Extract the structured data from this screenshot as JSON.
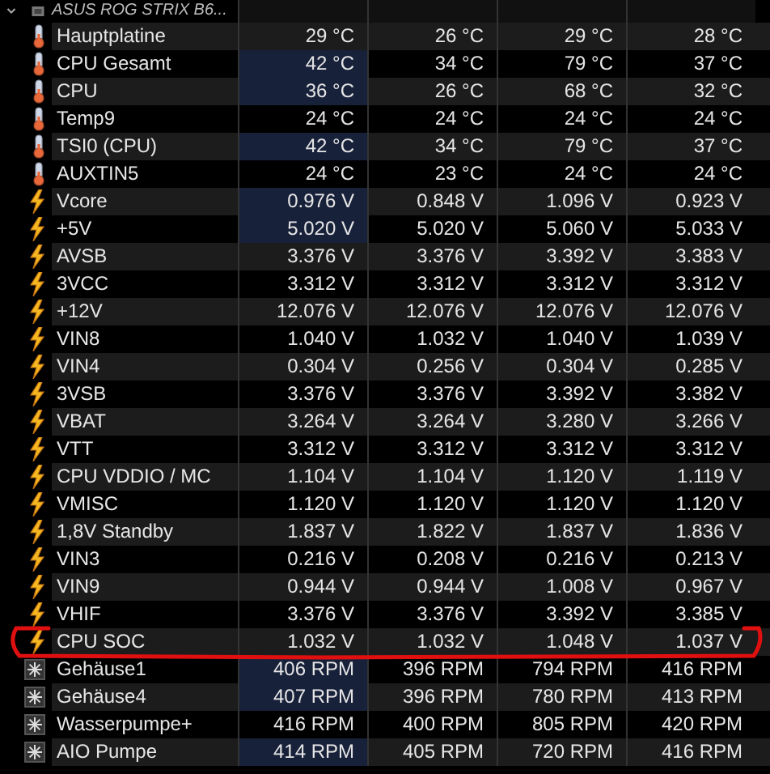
{
  "group": {
    "title": "ASUS ROG STRIX B6..."
  },
  "sensors": [
    {
      "kind": "temperature",
      "name": "Hauptplatine",
      "highlighted": false,
      "values": [
        "29 °C",
        "26 °C",
        "29 °C",
        "28 °C"
      ]
    },
    {
      "kind": "temperature",
      "name": "CPU Gesamt",
      "highlighted": true,
      "values": [
        "42 °C",
        "34 °C",
        "79 °C",
        "37 °C"
      ]
    },
    {
      "kind": "temperature",
      "name": "CPU",
      "highlighted": true,
      "values": [
        "36 °C",
        "26 °C",
        "68 °C",
        "32 °C"
      ]
    },
    {
      "kind": "temperature",
      "name": "Temp9",
      "highlighted": false,
      "values": [
        "24 °C",
        "24 °C",
        "24 °C",
        "24 °C"
      ]
    },
    {
      "kind": "temperature",
      "name": "TSI0 (CPU)",
      "highlighted": true,
      "values": [
        "42 °C",
        "34 °C",
        "79 °C",
        "37 °C"
      ]
    },
    {
      "kind": "temperature",
      "name": "AUXTIN5",
      "highlighted": false,
      "values": [
        "24 °C",
        "23 °C",
        "24 °C",
        "24 °C"
      ]
    },
    {
      "kind": "voltage",
      "name": "Vcore",
      "highlighted": true,
      "values": [
        "0.976 V",
        "0.848 V",
        "1.096 V",
        "0.923 V"
      ]
    },
    {
      "kind": "voltage",
      "name": "+5V",
      "highlighted": true,
      "values": [
        "5.020 V",
        "5.020 V",
        "5.060 V",
        "5.033 V"
      ]
    },
    {
      "kind": "voltage",
      "name": "AVSB",
      "highlighted": false,
      "values": [
        "3.376 V",
        "3.376 V",
        "3.392 V",
        "3.383 V"
      ]
    },
    {
      "kind": "voltage",
      "name": "3VCC",
      "highlighted": false,
      "values": [
        "3.312 V",
        "3.312 V",
        "3.312 V",
        "3.312 V"
      ]
    },
    {
      "kind": "voltage",
      "name": "+12V",
      "highlighted": false,
      "values": [
        "12.076 V",
        "12.076 V",
        "12.076 V",
        "12.076 V"
      ]
    },
    {
      "kind": "voltage",
      "name": "VIN8",
      "highlighted": false,
      "values": [
        "1.040 V",
        "1.032 V",
        "1.040 V",
        "1.039 V"
      ]
    },
    {
      "kind": "voltage",
      "name": "VIN4",
      "highlighted": false,
      "values": [
        "0.304 V",
        "0.256 V",
        "0.304 V",
        "0.285 V"
      ]
    },
    {
      "kind": "voltage",
      "name": "3VSB",
      "highlighted": false,
      "values": [
        "3.376 V",
        "3.376 V",
        "3.392 V",
        "3.382 V"
      ]
    },
    {
      "kind": "voltage",
      "name": "VBAT",
      "highlighted": false,
      "values": [
        "3.264 V",
        "3.264 V",
        "3.280 V",
        "3.266 V"
      ]
    },
    {
      "kind": "voltage",
      "name": "VTT",
      "highlighted": false,
      "values": [
        "3.312 V",
        "3.312 V",
        "3.312 V",
        "3.312 V"
      ]
    },
    {
      "kind": "voltage",
      "name": "CPU VDDIO / MC",
      "highlighted": false,
      "values": [
        "1.104 V",
        "1.104 V",
        "1.120 V",
        "1.119 V"
      ]
    },
    {
      "kind": "voltage",
      "name": "VMISC",
      "highlighted": false,
      "values": [
        "1.120 V",
        "1.120 V",
        "1.120 V",
        "1.120 V"
      ]
    },
    {
      "kind": "voltage",
      "name": "1,8V Standby",
      "highlighted": false,
      "values": [
        "1.837 V",
        "1.822 V",
        "1.837 V",
        "1.836 V"
      ]
    },
    {
      "kind": "voltage",
      "name": "VIN3",
      "highlighted": false,
      "values": [
        "0.216 V",
        "0.208 V",
        "0.216 V",
        "0.213 V"
      ]
    },
    {
      "kind": "voltage",
      "name": "VIN9",
      "highlighted": false,
      "values": [
        "0.944 V",
        "0.944 V",
        "1.008 V",
        "0.967 V"
      ]
    },
    {
      "kind": "voltage",
      "name": "VHIF",
      "highlighted": false,
      "values": [
        "3.376 V",
        "3.376 V",
        "3.392 V",
        "3.385 V"
      ]
    },
    {
      "kind": "voltage",
      "name": "CPU SOC",
      "highlighted": false,
      "values": [
        "1.032 V",
        "1.032 V",
        "1.048 V",
        "1.037 V"
      ]
    },
    {
      "kind": "fan",
      "name": "Gehäuse1",
      "highlighted": true,
      "values": [
        "406 RPM",
        "396 RPM",
        "794 RPM",
        "416 RPM"
      ]
    },
    {
      "kind": "fan",
      "name": "Gehäuse4",
      "highlighted": true,
      "values": [
        "407 RPM",
        "396 RPM",
        "780 RPM",
        "413 RPM"
      ]
    },
    {
      "kind": "fan",
      "name": "Wasserpumpe+",
      "highlighted": false,
      "values": [
        "416 RPM",
        "400 RPM",
        "805 RPM",
        "420 RPM"
      ]
    },
    {
      "kind": "fan",
      "name": "AIO Pumpe",
      "highlighted": true,
      "values": [
        "414 RPM",
        "405 RPM",
        "720 RPM",
        "416 RPM"
      ]
    }
  ]
}
